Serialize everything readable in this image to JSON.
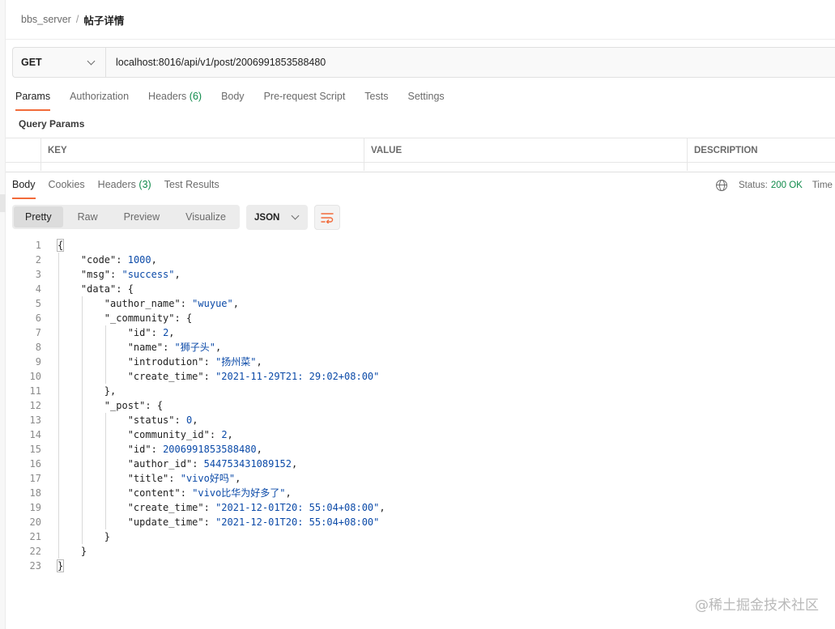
{
  "breadcrumb": {
    "parent": "bbs_server",
    "separator": "/",
    "current": "帖子详情"
  },
  "request": {
    "method": "GET",
    "url": "localhost:8016/api/v1/post/2006991853588480",
    "tabs": [
      {
        "label": "Params",
        "count": ""
      },
      {
        "label": "Authorization",
        "count": ""
      },
      {
        "label": "Headers",
        "count": "(6)"
      },
      {
        "label": "Body",
        "count": ""
      },
      {
        "label": "Pre-request Script",
        "count": ""
      },
      {
        "label": "Tests",
        "count": ""
      },
      {
        "label": "Settings",
        "count": ""
      }
    ]
  },
  "query_params": {
    "title": "Query Params",
    "columns": [
      "KEY",
      "VALUE",
      "DESCRIPTION"
    ]
  },
  "response": {
    "tabs": [
      {
        "label": "Body",
        "count": ""
      },
      {
        "label": "Cookies",
        "count": ""
      },
      {
        "label": "Headers",
        "count": "(3)"
      },
      {
        "label": "Test Results",
        "count": ""
      }
    ],
    "status_label": "Status:",
    "status_value": "200 OK",
    "time_label": "Time",
    "views": [
      "Pretty",
      "Raw",
      "Preview",
      "Visualize"
    ],
    "format": "JSON"
  },
  "code_lines": [
    "{",
    "    \"code\": 1000,",
    "    \"msg\": \"success\",",
    "    \"data\": {",
    "        \"author_name\": \"wuyue\",",
    "        \"_community\": {",
    "            \"id\": 2,",
    "            \"name\": \"狮子头\",",
    "            \"introdution\": \"扬州菜\",",
    "            \"create_time\": \"2021-11-29T21:29:02+08:00\"",
    "        },",
    "        \"_post\": {",
    "            \"status\": 0,",
    "            \"community_id\": 2,",
    "            \"id\": 2006991853588480,",
    "            \"author_id\": 544753431089152,",
    "            \"title\": \"vivo好吗\",",
    "            \"content\": \"vivo比华为好多了\",",
    "            \"create_time\": \"2021-12-01T20:55:04+08:00\",",
    "            \"update_time\": \"2021-12-01T20:55:04+08:00\"",
    "        }",
    "    }",
    "}"
  ],
  "watermark": "@稀土掘金技术社区",
  "colors": {
    "accent": "#f26b3a",
    "status_ok": "#0f8a4a",
    "json_value": "#0b4aa8"
  }
}
